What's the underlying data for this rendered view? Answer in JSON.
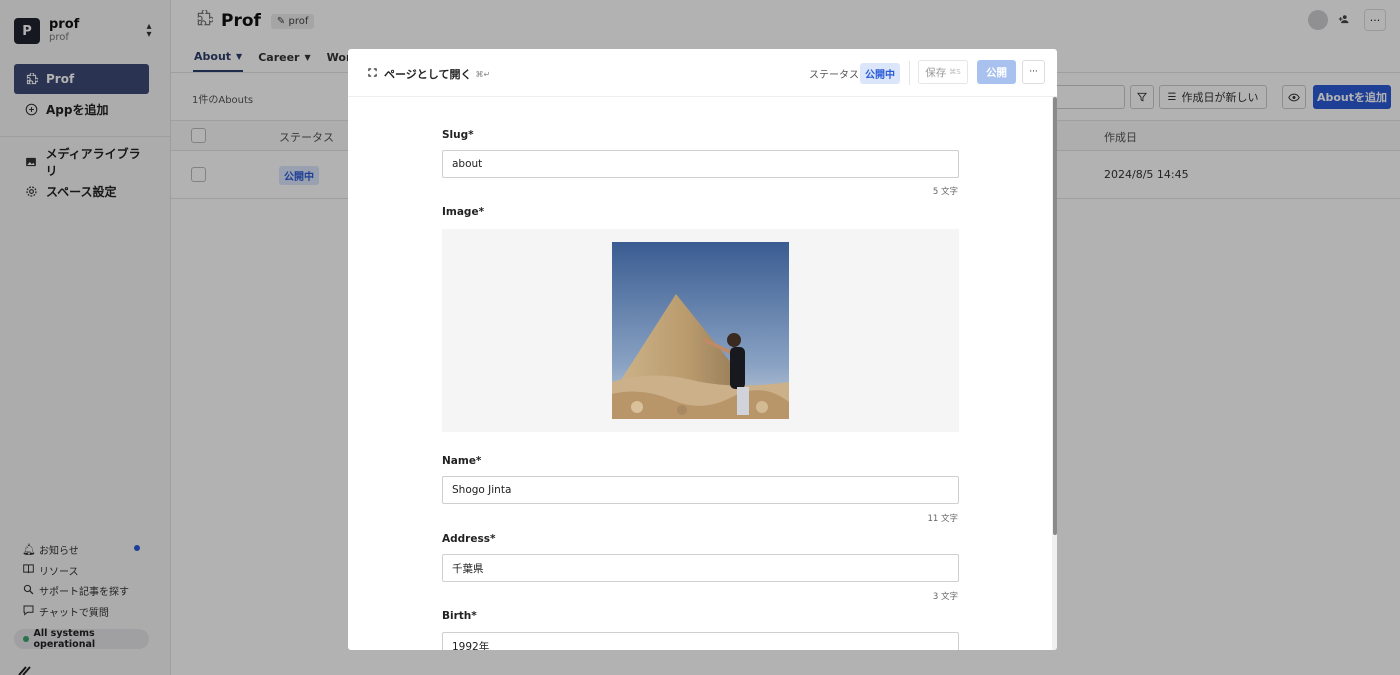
{
  "sidebar": {
    "workspace": {
      "initial": "P",
      "name": "prof",
      "sub": "prof"
    },
    "nav": [
      {
        "label": "Prof",
        "icon": "puzzle-icon"
      },
      {
        "label": "Appを追加",
        "icon": "plus-circle-icon"
      },
      {
        "label": "メディアライブラリ",
        "icon": "image-icon"
      },
      {
        "label": "スペース設定",
        "icon": "gear-icon"
      }
    ],
    "bottom": [
      {
        "label": "お知らせ",
        "icon": "bell-icon"
      },
      {
        "label": "リソース",
        "icon": "book-icon"
      },
      {
        "label": "サポート記事を探す",
        "icon": "search-icon"
      },
      {
        "label": "チャットで質問",
        "icon": "chat-icon"
      }
    ],
    "status": "All systems operational"
  },
  "main": {
    "title": "Prof",
    "api_chip": "prof",
    "tabs": [
      {
        "label": "About"
      },
      {
        "label": "Career"
      },
      {
        "label": "Work"
      }
    ],
    "count": "1件のAbouts",
    "sort_label": "作成日が新しい",
    "add_label": "Aboutを追加",
    "table": {
      "headers": {
        "status": "ステータス",
        "created": "作成日"
      },
      "row": {
        "status": "公開中",
        "created": "2024/8/5 14:45"
      }
    }
  },
  "modal": {
    "open_page": "ページとして開く",
    "open_page_kbd": "⌘↵",
    "status_label": "ステータス",
    "status_value": "公開中",
    "save_label": "保存",
    "save_kbd": "⌘S",
    "publish_label": "公開",
    "more": "···",
    "fields": {
      "slug": {
        "label": "Slug*",
        "value": "about",
        "count": "5 文字"
      },
      "image": {
        "label": "Image*"
      },
      "name": {
        "label": "Name*",
        "value": "Shogo Jinta",
        "count": "11 文字"
      },
      "address": {
        "label": "Address*",
        "value": "千葉県",
        "count": "3 文字"
      },
      "birth": {
        "label": "Birth*",
        "value": "1992年"
      }
    }
  },
  "colors": {
    "accent": "#2b5bd7",
    "sidebar_active": "#3d4a75",
    "badge_bg": "#dbe6fb"
  }
}
